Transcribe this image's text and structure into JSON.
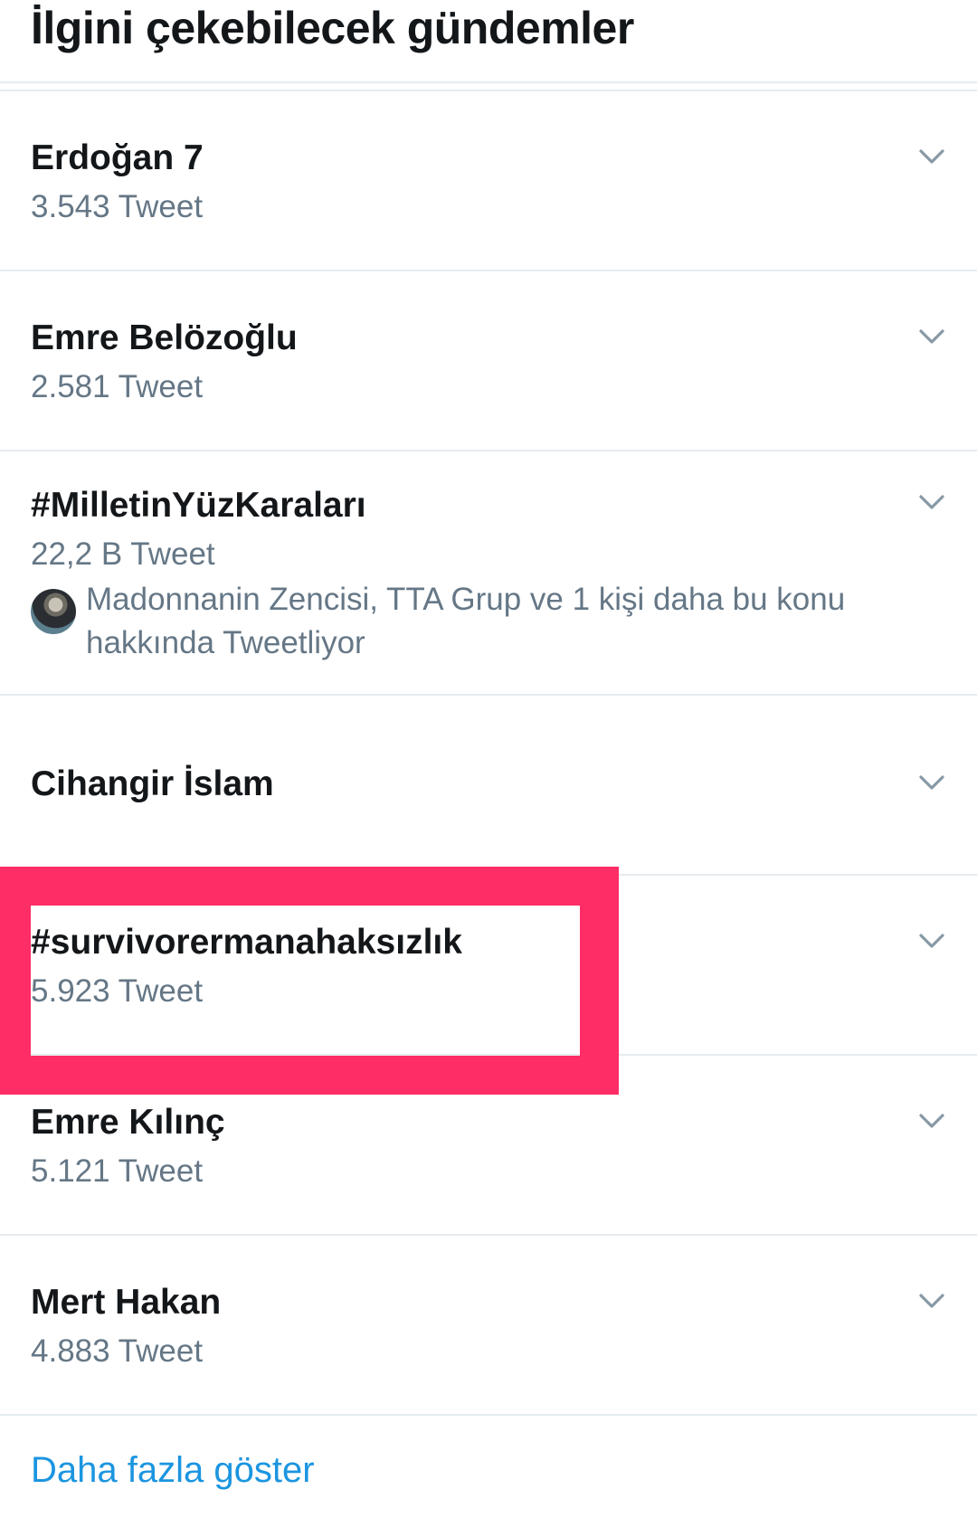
{
  "header": {
    "title": "İlgini çekebilecek gündemler"
  },
  "trends": [
    {
      "name": "Erdoğan 7",
      "count": "3.543 Tweet"
    },
    {
      "name": "Emre Belözoğlu",
      "count": "2.581 Tweet"
    },
    {
      "name": "#MilletinYüzKaraları",
      "count": "22,2 B Tweet",
      "context_line1": "Madonnanin Zencisi, TTA Grup ve 1 kişi daha bu konu",
      "context_line2": "hakkında Tweetliyor"
    },
    {
      "name": "Cihangir İslam"
    },
    {
      "name": "#survivorermanahaksızlık",
      "count": "5.923 Tweet"
    },
    {
      "name": "Emre Kılınç",
      "count": "5.121 Tweet"
    },
    {
      "name": "Mert Hakan",
      "count": "4.883 Tweet"
    }
  ],
  "show_more": {
    "label": "Daha fazla göster"
  },
  "colors": {
    "primary_text": "#14171a",
    "secondary_text": "#657786",
    "link": "#1b95e0",
    "divider": "#e6ecf0",
    "highlight_frame": "#ff2d66"
  },
  "icons": {
    "trend_menu": "chevron-down-icon",
    "context_avatar": "avatar"
  }
}
